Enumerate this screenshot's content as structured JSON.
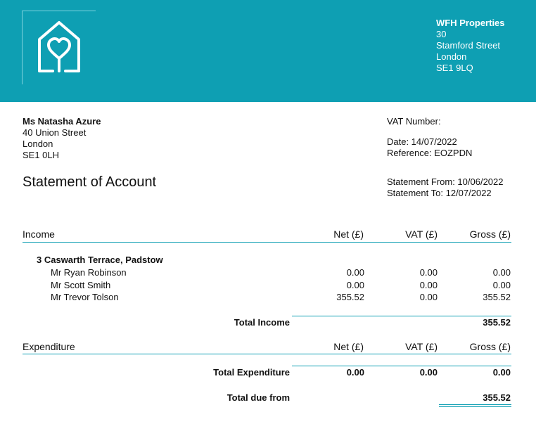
{
  "company": {
    "name": "WFH Properties",
    "address": [
      "30",
      "Stamford Street",
      "London",
      "SE1 9LQ"
    ]
  },
  "recipient": {
    "name": "Ms Natasha Azure",
    "address": [
      "40 Union Street",
      "London",
      "SE1 0LH"
    ]
  },
  "meta": {
    "vat_number": "VAT Number:",
    "date": "Date: 14/07/2022",
    "reference": "Reference: EOZPDN",
    "statement_from": "Statement From: 10/06/2022",
    "statement_to": "Statement To: 12/07/2022"
  },
  "title": "Statement of Account",
  "income": {
    "header": "Income",
    "columns": [
      "Net (£)",
      "VAT (£)",
      "Gross (£)"
    ],
    "property": "3 Caswarth Terrace, Padstow",
    "rows": [
      {
        "name": "Mr Ryan Robinson",
        "net": "0.00",
        "vat": "0.00",
        "gross": "0.00"
      },
      {
        "name": "Mr Scott Smith",
        "net": "0.00",
        "vat": "0.00",
        "gross": "0.00"
      },
      {
        "name": "Mr Trevor Tolson",
        "net": "355.52",
        "vat": "0.00",
        "gross": "355.52"
      }
    ],
    "total_label": "Total Income",
    "total_gross": "355.52"
  },
  "expenditure": {
    "header": "Expenditure",
    "columns": [
      "Net (£)",
      "VAT (£)",
      "Gross (£)"
    ],
    "total_label": "Total Expenditure",
    "total_net": "0.00",
    "total_vat": "0.00",
    "total_gross": "0.00"
  },
  "due": {
    "label": "Total due from",
    "amount": "355.52"
  },
  "colors": {
    "accent": "#0e9fb3"
  }
}
